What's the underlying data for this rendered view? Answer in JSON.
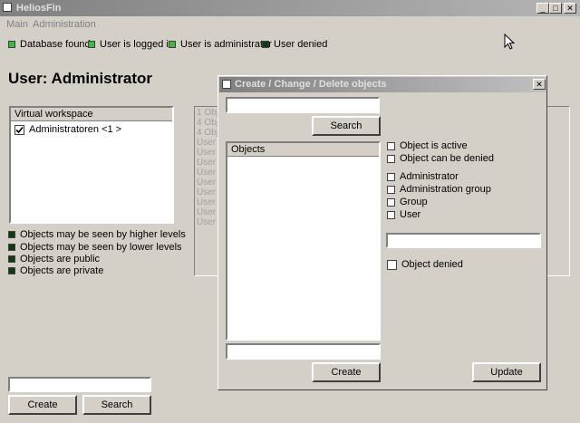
{
  "window": {
    "title": "HeliosFin",
    "min_glyph": "_",
    "max_glyph": "□",
    "close_glyph": "✕"
  },
  "menu": [
    "Main",
    "Administration"
  ],
  "status": [
    {
      "label": "Database found",
      "state": "on"
    },
    {
      "label": "User is logged in",
      "state": "on"
    },
    {
      "label": "User is administrator",
      "state": "on"
    },
    {
      "label": "User denied",
      "state": "dark"
    }
  ],
  "heading": "User: Administrator",
  "workspace": {
    "header": "Virtual workspace",
    "items": [
      {
        "label": "Administratoren <1 >",
        "checked": true
      }
    ]
  },
  "legend": [
    "Objects may be seen by higher levels",
    "Objects may be seen by lower levels",
    "Objects are public",
    "Objects are private"
  ],
  "main_search": {
    "value": "",
    "create_label": "Create",
    "search_label": "Search"
  },
  "background_list": [
    "1 Obj",
    "4 Obj",
    "4 Obj",
    "User",
    "User",
    "User",
    "User",
    "User",
    "User",
    "User",
    "User",
    "User"
  ],
  "dialog": {
    "title": "Create / Change / Delete objects",
    "close_glyph": "✕",
    "search_value": "",
    "search_label": "Search",
    "objects_header": "Objects",
    "bottom_input_value": "",
    "create_label": "Create",
    "update_label": "Update",
    "options": [
      "Object is active",
      "Object can be denied"
    ],
    "types": [
      "Administrator",
      "Administration group",
      "Group",
      "User"
    ],
    "name_value": "",
    "denied_label": "Object denied"
  },
  "colors": {
    "led_on": "#3fb83f",
    "led_dark": "#0e3c0e",
    "background": "#d4d0c8"
  }
}
